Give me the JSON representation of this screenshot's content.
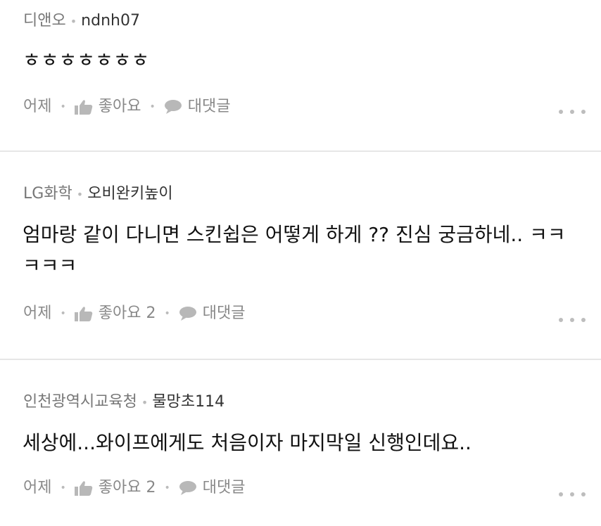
{
  "comments": [
    {
      "group": "디앤오",
      "nickname": "ndnh07",
      "text": "ㅎㅎㅎㅎㅎㅎㅎ",
      "time": "어제",
      "like_label": "좋아요",
      "reply_label": "대댓글"
    },
    {
      "group": "LG화학",
      "nickname": "오비완키높이",
      "text": "엄마랑 같이 다니면 스킨쉽은 어떻게 하게 ?? 진심 궁금하네.. ㅋㅋㅋㅋㅋ",
      "time": "어제",
      "like_label": "좋아요 2",
      "reply_label": "대댓글"
    },
    {
      "group": "인천광역시교육청",
      "nickname": "물망초114",
      "text": "세상에...와이프에게도 처음이자 마지막일 신행인데요..",
      "time": "어제",
      "like_label": "좋아요 2",
      "reply_label": "대댓글"
    }
  ],
  "icons": {
    "like": "thumbs-up-icon",
    "reply": "speech-bubble-icon",
    "more": "more-dots-icon"
  },
  "colors": {
    "meta": "#777777",
    "body": "#111111",
    "icon": "#b8b8b8",
    "divider": "#e6e6e6"
  }
}
